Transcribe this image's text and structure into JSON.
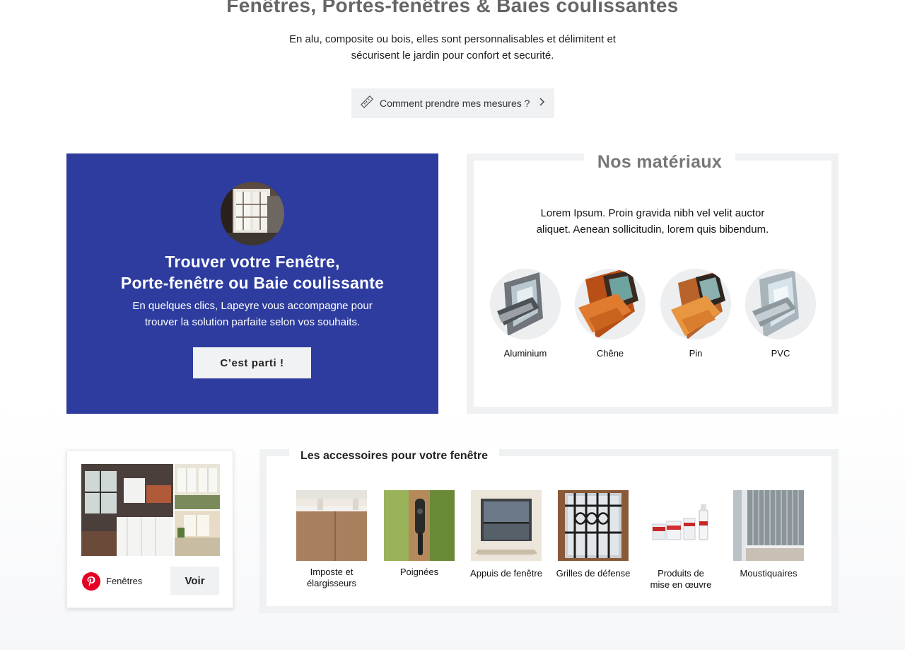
{
  "header": {
    "title": "Fenêtres, Portes-fenêtres & Baies coulissantes",
    "subtitle_line1": "En alu, composite ou bois, elles sont personnalisables et délimitent et",
    "subtitle_line2": "sécurisent le jardin pour confort et securité.",
    "measure_button": "Comment prendre mes mesures ?"
  },
  "finder": {
    "title_line1": "Trouver votre Fenêtre,",
    "title_line2": "Porte-fenêtre ou Baie coulissante",
    "text_line1": "En quelques clics, Lapeyre vous accompagne pour",
    "text_line2": "trouver la solution parfaite selon vos souhaits.",
    "button": "C’est parti !"
  },
  "materials": {
    "title": "Nos matériaux",
    "text_line1": "Lorem Ipsum. Proin gravida nibh vel velit auctor",
    "text_line2": "aliquet. Aenean sollicitudin, lorem quis bibendum.",
    "items": [
      {
        "label": "Aluminium",
        "color": "#8a8f94"
      },
      {
        "label": "Chêne",
        "color": "#d4601a"
      },
      {
        "label": "Pin",
        "color": "#e0833a"
      },
      {
        "label": "PVC",
        "color": "#c9d2d8"
      }
    ]
  },
  "pinterest": {
    "board_label": "Fenêtres",
    "button": "Voir",
    "brand_color": "#e60023"
  },
  "accessories": {
    "title": "Les accessoires pour votre fenêtre",
    "items": [
      {
        "label_line1": "Imposte et",
        "label_line2": "élargisseurs"
      },
      {
        "label_line1": "Poignées",
        "label_line2": ""
      },
      {
        "label_line1": "Appuis de fenêtre",
        "label_line2": ""
      },
      {
        "label_line1": "Grilles de défense",
        "label_line2": ""
      },
      {
        "label_line1": "Produits de",
        "label_line2": "mise en œuvre"
      },
      {
        "label_line1": "Moustiquaires",
        "label_line2": ""
      }
    ]
  },
  "colors": {
    "finder_bg": "#2d3c9e",
    "panel_border": "#eff1f3",
    "button_bg": "#eff1f3"
  }
}
